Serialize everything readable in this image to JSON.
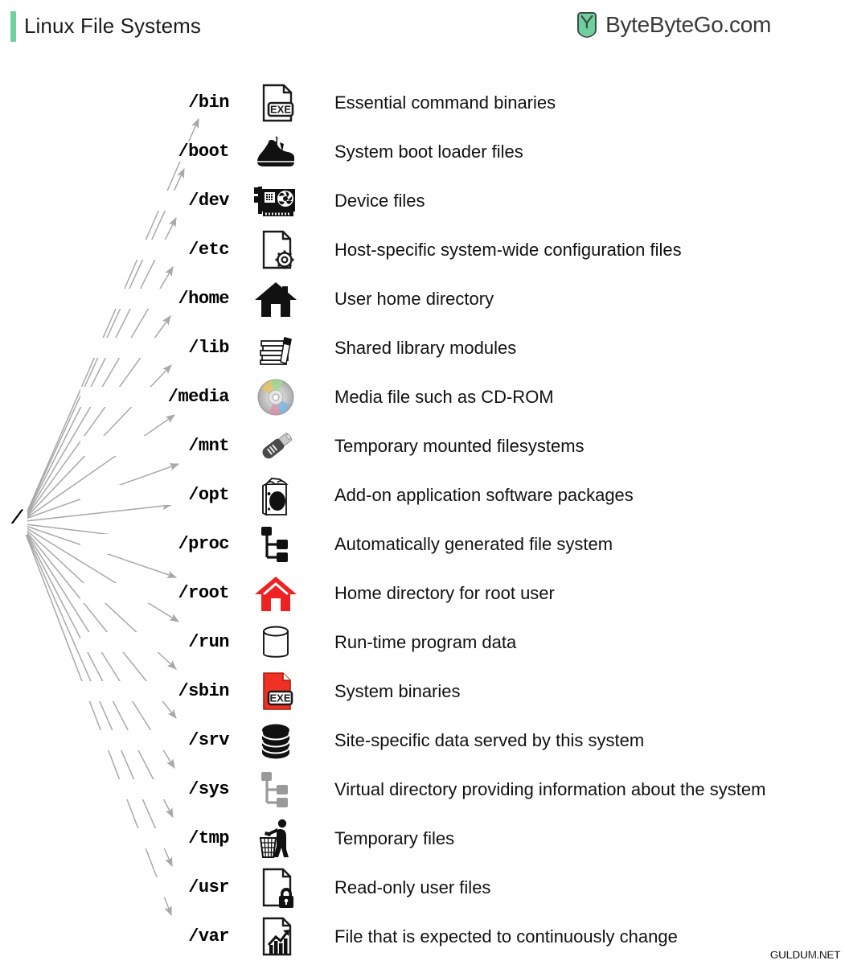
{
  "header": {
    "title": "Linux File Systems",
    "accent_color": "#71cfa0",
    "brand_text": "ByteByteGo.com",
    "brand_logo_icon": "bytebytego-shield-logo-icon"
  },
  "tree": {
    "root_label": "/",
    "arrow_color": "#a8a8a8"
  },
  "rows": [
    {
      "path": "/bin",
      "icon": "exe-file-icon",
      "description": "Essential command binaries"
    },
    {
      "path": "/boot",
      "icon": "boot-shoe-icon",
      "description": "System boot loader files"
    },
    {
      "path": "/dev",
      "icon": "expansion-card-icon",
      "description": "Device files"
    },
    {
      "path": "/etc",
      "icon": "file-gear-icon",
      "description": "Host-specific system-wide configuration files"
    },
    {
      "path": "/home",
      "icon": "house-icon",
      "description": "User home directory"
    },
    {
      "path": "/lib",
      "icon": "book-stack-icon",
      "description": "Shared library modules"
    },
    {
      "path": "/media",
      "icon": "cd-disc-icon",
      "description": "Media file such as CD-ROM"
    },
    {
      "path": "/mnt",
      "icon": "usb-drive-icon",
      "description": "Temporary mounted filesystems"
    },
    {
      "path": "/opt",
      "icon": "open-box-icon",
      "description": "Add-on application software packages"
    },
    {
      "path": "/proc",
      "icon": "tree-nodes-icon",
      "description": "Automatically generated file system"
    },
    {
      "path": "/root",
      "icon": "red-house-icon",
      "description": "Home directory for root user"
    },
    {
      "path": "/run",
      "icon": "cylinder-icon",
      "description": "Run-time program data"
    },
    {
      "path": "/sbin",
      "icon": "red-exe-file-icon",
      "description": "System binaries"
    },
    {
      "path": "/srv",
      "icon": "database-stack-icon",
      "description": "Site-specific data served by this system"
    },
    {
      "path": "/sys",
      "icon": "grey-tree-nodes-icon",
      "description": "Virtual directory providing information about the system"
    },
    {
      "path": "/tmp",
      "icon": "trash-person-icon",
      "description": "Temporary files"
    },
    {
      "path": "/usr",
      "icon": "file-lock-icon",
      "description": "Read-only user files"
    },
    {
      "path": "/var",
      "icon": "file-chart-icon",
      "description": "File that is expected to continuously change"
    }
  ],
  "watermark": "GULDUM.NET"
}
